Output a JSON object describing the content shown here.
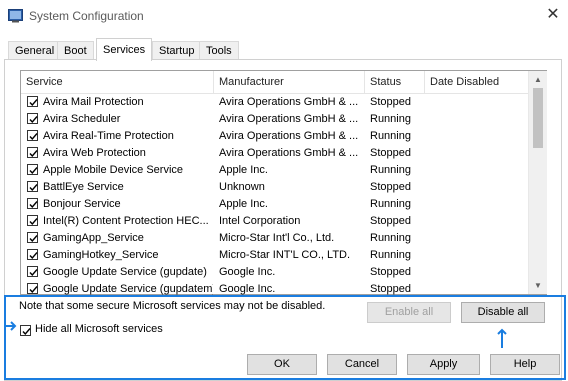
{
  "window": {
    "title": "System Configuration",
    "app_icon": "system-config-icon",
    "close_icon": "close-icon"
  },
  "tabs": [
    {
      "label": "General"
    },
    {
      "label": "Boot"
    },
    {
      "label": "Services",
      "active": true
    },
    {
      "label": "Startup"
    },
    {
      "label": "Tools"
    }
  ],
  "services_list": {
    "columns": [
      "Service",
      "Manufacturer",
      "Status",
      "Date Disabled"
    ],
    "rows": [
      {
        "checked": true,
        "service": "Avira Mail Protection",
        "manufacturer": "Avira Operations GmbH & ...",
        "status": "Stopped",
        "date_disabled": ""
      },
      {
        "checked": true,
        "service": "Avira Scheduler",
        "manufacturer": "Avira Operations GmbH & ...",
        "status": "Running",
        "date_disabled": ""
      },
      {
        "checked": true,
        "service": "Avira Real-Time Protection",
        "manufacturer": "Avira Operations GmbH & ...",
        "status": "Running",
        "date_disabled": ""
      },
      {
        "checked": true,
        "service": "Avira Web Protection",
        "manufacturer": "Avira Operations GmbH & ...",
        "status": "Stopped",
        "date_disabled": ""
      },
      {
        "checked": true,
        "service": "Apple Mobile Device Service",
        "manufacturer": "Apple Inc.",
        "status": "Running",
        "date_disabled": ""
      },
      {
        "checked": true,
        "service": "BattlEye Service",
        "manufacturer": "Unknown",
        "status": "Stopped",
        "date_disabled": ""
      },
      {
        "checked": true,
        "service": "Bonjour Service",
        "manufacturer": "Apple Inc.",
        "status": "Running",
        "date_disabled": ""
      },
      {
        "checked": true,
        "service": "Intel(R) Content Protection HEC...",
        "manufacturer": "Intel Corporation",
        "status": "Stopped",
        "date_disabled": ""
      },
      {
        "checked": true,
        "service": "GamingApp_Service",
        "manufacturer": "Micro-Star Int'l Co., Ltd.",
        "status": "Running",
        "date_disabled": ""
      },
      {
        "checked": true,
        "service": "GamingHotkey_Service",
        "manufacturer": "Micro-Star INT'L CO., LTD.",
        "status": "Running",
        "date_disabled": ""
      },
      {
        "checked": true,
        "service": "Google Update Service (gupdate)",
        "manufacturer": "Google Inc.",
        "status": "Stopped",
        "date_disabled": ""
      },
      {
        "checked": true,
        "service": "Google Update Service (gupdatem)",
        "manufacturer": "Google Inc.",
        "status": "Stopped",
        "date_disabled": ""
      }
    ]
  },
  "note": "Note that some secure Microsoft services may not be disabled.",
  "buttons": {
    "enable_all": "Enable all",
    "disable_all": "Disable all",
    "ok": "OK",
    "cancel": "Cancel",
    "apply": "Apply",
    "help": "Help"
  },
  "hide_ms": {
    "label": "Hide all Microsoft services",
    "checked": true
  },
  "colors": {
    "highlight": "#1a7de0"
  }
}
